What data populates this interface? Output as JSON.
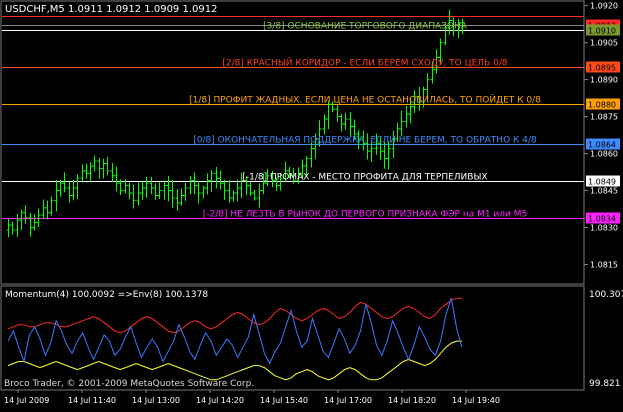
{
  "symbol_header": "USDCHF,M5  1.0911 1.0912 1.0909 1.0912",
  "price_scale": {
    "ticks": [
      {
        "label": "1.0920",
        "value": 1.092
      },
      {
        "label": "1.0905",
        "value": 1.0905
      },
      {
        "label": "1.0890",
        "value": 1.089
      },
      {
        "label": "1.0875",
        "value": 1.0875
      },
      {
        "label": "1.0860",
        "value": 1.086
      },
      {
        "label": "1.0845",
        "value": 1.0845
      },
      {
        "label": "1.0830",
        "value": 1.083
      },
      {
        "label": "1.0815",
        "value": 1.0815
      }
    ],
    "range": [
      1.08075,
      1.09215
    ]
  },
  "level_lines": [
    {
      "id": "level-3-8",
      "price": 1.0916,
      "color": "#ff2a2a",
      "label": "",
      "tag": "",
      "tag_color": "#ff2a2a"
    },
    {
      "id": "level-bid",
      "price": 1.0912,
      "color": "#888888",
      "label": "",
      "tag": "1.0912",
      "tag_color": "#ff2a2a"
    },
    {
      "id": "level-3-8-base",
      "price": 1.091,
      "color": "#ffffff",
      "label": "[3/8] ОСНОВАНИЕ ТОРГОВОГО ДИАПАЗОНА",
      "tag": "1.0910",
      "tag_color": "#7a9a2a",
      "label_color": "#8cc83c"
    },
    {
      "id": "level-2-8",
      "price": 1.0895,
      "color": "#ff5020",
      "label": "[2/8] КРАСНЫЙ КОРИДОР - ЕСЛИ БЕРЕМ СХОДУ, ТО ЦЕЛЬ 0/8",
      "tag": "1.0895",
      "tag_color": "#ff4a1a",
      "label_color": "#ff4020"
    },
    {
      "id": "level-1-8",
      "price": 1.088,
      "color": "#ffa000",
      "label": "[1/8] ПРОФИТ ЖАДНЫХ. ЕСЛИ ЦЕНА НЕ ОСТАНОВИЛАСЬ, ТО ПОЙДЕТ К 0/8",
      "tag": "1.0880",
      "tag_color": "#ffa000",
      "label_color": "#ffa000"
    },
    {
      "id": "level-0-8",
      "price": 1.0864,
      "color": "#3c8cff",
      "label": "[0/8] ОКОНЧАТЕЛЬНАЯ ПОДДЕРЖКА. ЕСЛИ НЕ БЕРЕМ, ТО ОБРАТНО К 4/8",
      "tag": "1.0864",
      "tag_color": "#3c8cff",
      "label_color": "#3c8cff"
    },
    {
      "id": "level-m1-8",
      "price": 1.0849,
      "color": "#ffffff",
      "label": "[-1/8] ПРОМАХ - МЕСТО ПРОФИТА ДЛЯ ТЕРПЕЛИВЫХ",
      "tag": "1.0849",
      "tag_color": "#ffffff",
      "label_color": "#ffffff"
    },
    {
      "id": "level-m2-8",
      "price": 1.0834,
      "color": "#ff20ff",
      "label": "[-2/8] НЕ ЛЕЗТЬ В РЫНОК ДО ПЕРВОГО ПРИЗНАКА ФЭР на М1 или М5",
      "tag": "1.0834",
      "tag_color": "#ff20ff",
      "label_color": "#ff20ff"
    }
  ],
  "candles_close": [
    1.0831,
    1.0829,
    1.0833,
    1.0836,
    1.0834,
    1.083,
    1.0832,
    1.0835,
    1.0838,
    1.0836,
    1.0841,
    1.0845,
    1.0848,
    1.0846,
    1.0843,
    1.0846,
    1.085,
    1.0853,
    1.0852,
    1.0855,
    1.0857,
    1.0854,
    1.0856,
    1.0853,
    1.0851,
    1.0848,
    1.0845,
    1.0847,
    1.0844,
    1.0841,
    1.0844,
    1.0846,
    1.0848,
    1.0846,
    1.0843,
    1.0845,
    1.0847,
    1.0845,
    1.0842,
    1.084,
    1.0843,
    1.0846,
    1.0849,
    1.0847,
    1.0844,
    1.0846,
    1.0849,
    1.0852,
    1.085,
    1.0848,
    1.0845,
    1.0842,
    1.0844,
    1.0846,
    1.0849,
    1.0847,
    1.0844,
    1.0842,
    1.0845,
    1.0848,
    1.0851,
    1.0849,
    1.0847,
    1.085,
    1.0853,
    1.0851,
    1.0849,
    1.0852,
    1.0855,
    1.0858,
    1.0862,
    1.0866,
    1.087,
    1.0874,
    1.088,
    1.0878,
    1.0875,
    1.0872,
    1.0874,
    1.0871,
    1.0868,
    1.0866,
    1.0864,
    1.0861,
    1.0862,
    1.0864,
    1.0861,
    1.0858,
    1.0862,
    1.0866,
    1.087,
    1.0873,
    1.0876,
    1.0879,
    1.0883,
    1.0881,
    1.0886,
    1.089,
    1.0894,
    1.0899,
    1.0905,
    1.0911,
    1.0914,
    1.091,
    1.0913,
    1.0912
  ],
  "time_axis": [
    "14 Jul 2009",
    "14 Jul 11:40",
    "14 Jul 13:00",
    "14 Jul 14:20",
    "14 Jul 15:40",
    "14 Jul 17:00",
    "14 Jul 18:20",
    "14 Jul 19:40"
  ],
  "indicator": {
    "header": "Momentum(4) 100.0092  =>Env(8) 100.1378",
    "scale_top": "100.307",
    "scale_bottom": "99.821",
    "range": [
      99.82,
      100.31
    ],
    "watermark": "Broco Trader, © 2001-2009 MetaQuotes Software Corp.",
    "momentum_color": "#3c78ff",
    "upper_env_color": "#ff2a2a",
    "lower_env_color": "#ffff30",
    "momentum": [
      100.05,
      100.1,
      100.02,
      99.95,
      100.08,
      100.12,
      100.06,
      99.98,
      100.04,
      100.15,
      100.1,
      100.03,
      99.99,
      100.05,
      100.09,
      100.02,
      99.96,
      100.02,
      100.08,
      100.05,
      99.98,
      100.01,
      100.07,
      100.12,
      100.04,
      99.97,
      100.02,
      100.06,
      100.02,
      99.95,
      100.0,
      100.05,
      100.13,
      100.07,
      100.0,
      99.96,
      100.03,
      100.09,
      100.05,
      99.98,
      100.02,
      100.06,
      100.03,
      99.97,
      100.02,
      100.07,
      100.18,
      100.09,
      99.99,
      99.94,
      100.0,
      100.04,
      100.12,
      100.2,
      100.1,
      100.02,
      100.05,
      100.16,
      100.08,
      100.0,
      99.97,
      100.04,
      100.11,
      100.06,
      99.99,
      100.03,
      100.1,
      100.23,
      100.14,
      100.03,
      99.98,
      100.05,
      100.15,
      100.09,
      100.02,
      99.96,
      100.03,
      100.12,
      100.07,
      100.01,
      99.98,
      100.05,
      100.18,
      100.26,
      100.11,
      100.02
    ],
    "upper_env": [
      100.11,
      100.12,
      100.13,
      100.13,
      100.12,
      100.12,
      100.13,
      100.14,
      100.14,
      100.13,
      100.12,
      100.12,
      100.13,
      100.14,
      100.15,
      100.16,
      100.17,
      100.16,
      100.14,
      100.12,
      100.1,
      100.09,
      100.1,
      100.12,
      100.14,
      100.16,
      100.17,
      100.16,
      100.14,
      100.12,
      100.1,
      100.09,
      100.1,
      100.12,
      100.14,
      100.15,
      100.14,
      100.12,
      100.11,
      100.12,
      100.14,
      100.16,
      100.18,
      100.19,
      100.18,
      100.16,
      100.14,
      100.13,
      100.14,
      100.16,
      100.19,
      100.21,
      100.2,
      100.18,
      100.16,
      100.15,
      100.16,
      100.18,
      100.2,
      100.21,
      100.2,
      100.18,
      100.16,
      100.17,
      100.19,
      100.22,
      100.24,
      100.23,
      100.21,
      100.19,
      100.17,
      100.16,
      100.17,
      100.19,
      100.21,
      100.22,
      100.21,
      100.19,
      100.17,
      100.16,
      100.18,
      100.21,
      100.23,
      100.25,
      100.26,
      100.26
    ],
    "lower_env": [
      99.93,
      99.94,
      99.95,
      99.95,
      99.94,
      99.93,
      99.92,
      99.93,
      99.94,
      99.95,
      99.94,
      99.93,
      99.92,
      99.91,
      99.92,
      99.93,
      99.94,
      99.95,
      99.94,
      99.93,
      99.92,
      99.91,
      99.92,
      99.93,
      99.94,
      99.93,
      99.92,
      99.91,
      99.92,
      99.93,
      99.94,
      99.93,
      99.92,
      99.91,
      99.9,
      99.89,
      99.88,
      99.87,
      99.86,
      99.86,
      99.87,
      99.88,
      99.89,
      99.9,
      99.91,
      99.92,
      99.93,
      99.93,
      99.92,
      99.9,
      99.88,
      99.87,
      99.86,
      99.87,
      99.89,
      99.9,
      99.91,
      99.9,
      99.88,
      99.87,
      99.86,
      99.87,
      99.89,
      99.91,
      99.92,
      99.91,
      99.89,
      99.87,
      99.86,
      99.86,
      99.87,
      99.89,
      99.91,
      99.93,
      99.95,
      99.96,
      99.95,
      99.94,
      99.93,
      99.94,
      99.96,
      99.99,
      100.02,
      100.04,
      100.05,
      100.05
    ]
  }
}
